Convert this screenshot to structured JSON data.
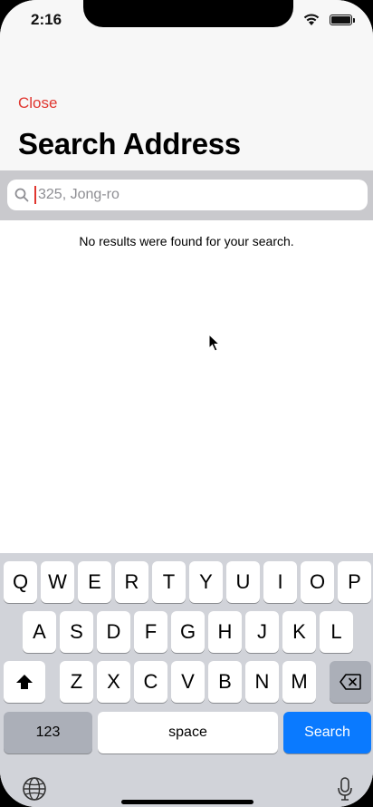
{
  "status_bar": {
    "time": "2:16"
  },
  "header": {
    "close_label": "Close",
    "title": "Search Address"
  },
  "search": {
    "placeholder": "325, Jong-ro",
    "value": ""
  },
  "results": {
    "empty_message": "No results were found for your search."
  },
  "keyboard": {
    "row1": [
      "Q",
      "W",
      "E",
      "R",
      "T",
      "Y",
      "U",
      "I",
      "O",
      "P"
    ],
    "row2": [
      "A",
      "S",
      "D",
      "F",
      "G",
      "H",
      "J",
      "K",
      "L"
    ],
    "row3": [
      "Z",
      "X",
      "C",
      "V",
      "B",
      "N",
      "M"
    ],
    "numbers_label": "123",
    "space_label": "space",
    "search_label": "Search"
  },
  "colors": {
    "accent": "#e0362f",
    "search_key": "#0a7aff",
    "keyboard_bg": "#d1d3d9"
  }
}
